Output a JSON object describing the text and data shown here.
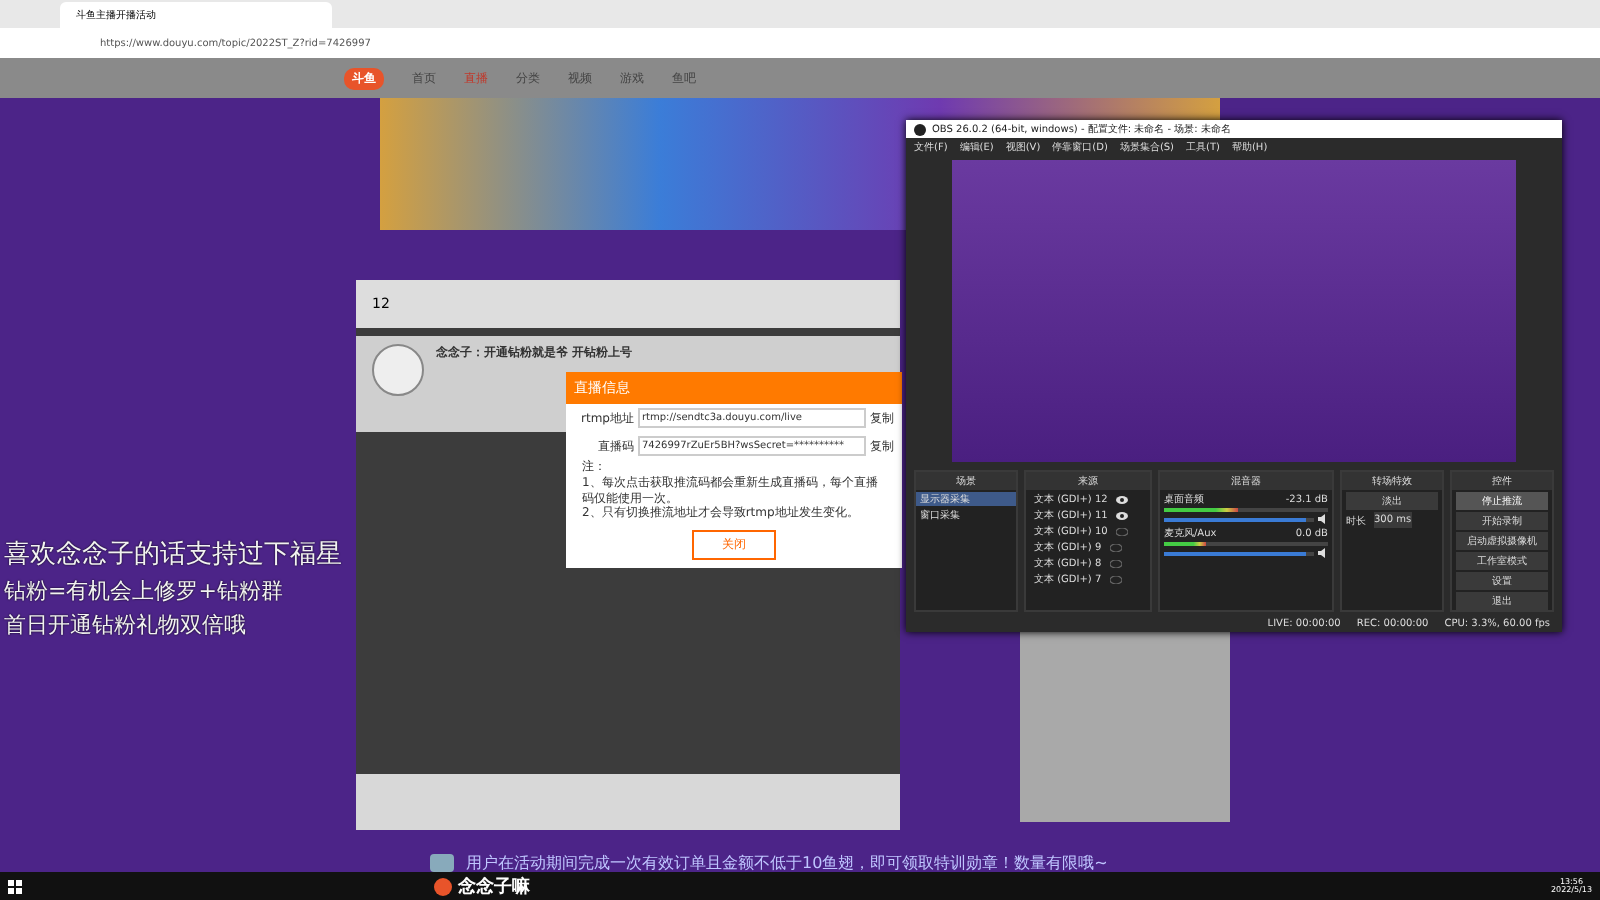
{
  "browser": {
    "tab_title": "斗鱼主播开播活动",
    "url": "https://www.douyu.com/topic/2022ST_Z?rid=7426997",
    "logo": "斗鱼",
    "nav": [
      {
        "label": "首页",
        "selected": false
      },
      {
        "label": "直播",
        "selected": true
      },
      {
        "label": "分类",
        "selected": false
      },
      {
        "label": "视频",
        "selected": false
      },
      {
        "label": "游戏",
        "selected": false
      },
      {
        "label": "鱼吧",
        "selected": false
      }
    ]
  },
  "stream_page": {
    "follower_count": "12",
    "room_title": "念念子：开通钻粉就是爷 开钻粉上号",
    "dialog": {
      "title": "直播信息",
      "fields": [
        {
          "label": "rtmp地址",
          "value": "rtmp://sendtc3a.douyu.com/live",
          "action": "复制"
        },
        {
          "label": "直播码",
          "value": "7426997rZuEr5BH?wsSecret=**********",
          "action": "复制"
        }
      ],
      "notes": [
        "注：",
        "1、每次点击获取推流码都会重新生成直播码，每个直播码仅能使用一次。",
        "2、只有切换推流地址才会导致rtmp地址发生变化。"
      ],
      "close": "关闭"
    }
  },
  "overlay_text": [
    "喜欢念念子的话支持过下福星",
    "钻粉=有机会上修罗+钻粉群",
    "首日开通钻粉礼物双倍哦"
  ],
  "obs": {
    "title": "OBS 26.0.2 (64-bit, windows) - 配置文件: 未命名 - 场景: 未命名",
    "menu": [
      "文件(F)",
      "编辑(E)",
      "视图(V)",
      "停靠窗口(D)",
      "场景集合(S)",
      "工具(T)",
      "帮助(H)"
    ],
    "scenes": {
      "title": "场景",
      "items": [
        {
          "label": "显示器采集",
          "selected": true
        },
        {
          "label": "窗口采集",
          "selected": false
        }
      ]
    },
    "sources": {
      "title": "来源",
      "items": [
        {
          "label": "文本 (GDI+) 12",
          "visible": true
        },
        {
          "label": "文本 (GDI+) 11",
          "visible": true
        },
        {
          "label": "文本 (GDI+) 10",
          "visible": false
        },
        {
          "label": "文本 (GDI+) 9",
          "visible": false
        },
        {
          "label": "文本 (GDI+) 8",
          "visible": false
        },
        {
          "label": "文本 (GDI+) 7",
          "visible": false
        }
      ]
    },
    "mixer": {
      "title": "混音器",
      "channels": [
        {
          "name": "桌面音频",
          "reading": "-23.1 dB",
          "level": 0.45,
          "volume": {
            "level": 0.95
          }
        },
        {
          "name": "麦克风/Aux",
          "reading": "0.0 dB",
          "level": 0.25,
          "volume": {
            "level": 0.95
          }
        }
      ]
    },
    "transitions": {
      "title": "转场特效",
      "type": "淡出",
      "duration_label": "时长",
      "duration": "300 ms"
    },
    "controls": {
      "title": "控件",
      "buttons": [
        {
          "label": "停止推流",
          "active": true
        },
        {
          "label": "开始录制",
          "active": false
        },
        {
          "label": "启动虚拟摄像机",
          "active": false
        },
        {
          "label": "工作室模式",
          "active": false
        },
        {
          "label": "设置",
          "active": false
        },
        {
          "label": "退出",
          "active": false
        }
      ]
    },
    "status": [
      "LIVE: 00:00:00",
      "REC: 00:00:00",
      "CPU: 3.3%, 60.00 fps"
    ]
  },
  "banner_text": "用户在活动期间完成一次有效订单且金额不低于10鱼翅，即可领取特训勋章！数量有限哦~",
  "taskbar": {
    "app_label": "念念子嘛",
    "time": "13:56",
    "date": "2022/5/13"
  }
}
